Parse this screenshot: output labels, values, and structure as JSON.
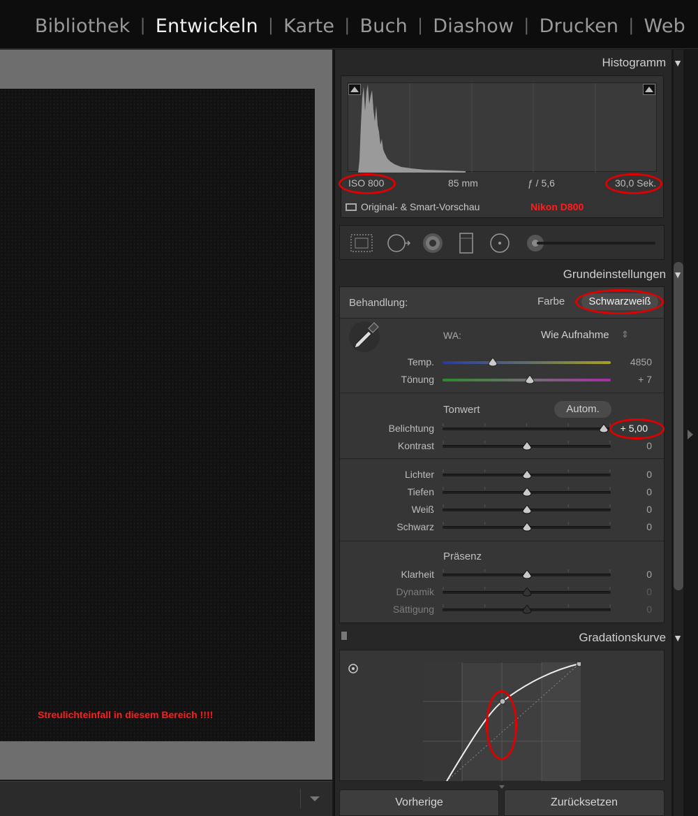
{
  "modules": {
    "items": [
      "Bibliothek",
      "Entwickeln",
      "Karte",
      "Buch",
      "Diashow",
      "Drucken",
      "Web"
    ],
    "separator": "|",
    "active": "Entwickeln"
  },
  "photo": {
    "annotation": "Streulichteinfall in diesem Bereich !!!!"
  },
  "histogram": {
    "title": "Histogramm",
    "iso": "ISO 800",
    "focal_length": "85 mm",
    "aperture": "ƒ / 5,6",
    "shutter": "30,0 Sek.",
    "preview_label": "Original- & Smart-Vorschau",
    "camera_note": "Nikon D800"
  },
  "basic": {
    "title": "Grundeinstellungen",
    "treatment_label": "Behandlung:",
    "treatment_color": "Farbe",
    "treatment_bw": "Schwarzweiß",
    "wb_label": "WA:",
    "wb_value": "Wie Aufnahme",
    "wb_stepper": "⇕",
    "temp_label": "Temp.",
    "temp_value": "4850",
    "tint_label": "Tönung",
    "tint_value": "+ 7",
    "tone_label": "Tonwert",
    "auto_label": "Autom.",
    "tone_sliders": [
      {
        "label": "Belichtung",
        "value": "+ 5,00",
        "pos": 0.96
      },
      {
        "label": "Kontrast",
        "value": "0",
        "pos": 0.5
      }
    ],
    "light_sliders": [
      {
        "label": "Lichter",
        "value": "0",
        "pos": 0.5
      },
      {
        "label": "Tiefen",
        "value": "0",
        "pos": 0.5
      },
      {
        "label": "Weiß",
        "value": "0",
        "pos": 0.5
      },
      {
        "label": "Schwarz",
        "value": "0",
        "pos": 0.5
      }
    ],
    "presence_label": "Präsenz",
    "presence_sliders": [
      {
        "label": "Klarheit",
        "value": "0",
        "pos": 0.5,
        "dim": false
      },
      {
        "label": "Dynamik",
        "value": "0",
        "pos": 0.5,
        "dim": true
      },
      {
        "label": "Sättigung",
        "value": "0",
        "pos": 0.5,
        "dim": true
      }
    ],
    "temp_pos": 0.3,
    "tint_pos": 0.52
  },
  "curve": {
    "title": "Gradationskurve"
  },
  "bottom": {
    "previous": "Vorherige",
    "reset": "Zurücksetzen"
  },
  "colors": {
    "annotation_red": "#e00000",
    "active_module": "#f2f2f2",
    "inactive_module": "#9a9a9a"
  }
}
